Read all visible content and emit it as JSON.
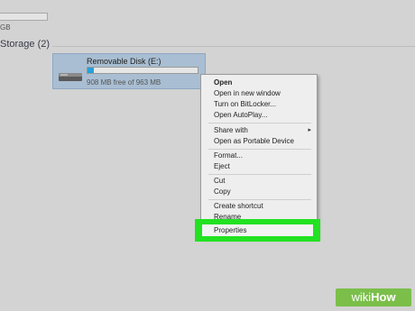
{
  "top": {
    "size_text": "GB"
  },
  "section": {
    "title": "Storage (2)"
  },
  "drive": {
    "name": "Removable Disk (E:)",
    "free_text": "908 MB free of 963 MB",
    "used_fraction": 0.057,
    "bar_color": "#26a0da"
  },
  "context_menu": {
    "items": [
      {
        "label": "Open",
        "bold": true
      },
      {
        "label": "Open in new window"
      },
      {
        "label": "Turn on BitLocker..."
      },
      {
        "label": "Open AutoPlay..."
      },
      {
        "label": "Share with",
        "has_submenu": true
      },
      {
        "label": "Open as Portable Device"
      },
      {
        "label": "Format..."
      },
      {
        "label": "Eject"
      },
      {
        "label": "Cut"
      },
      {
        "label": "Copy"
      },
      {
        "label": "Create shortcut"
      },
      {
        "label": "Rename"
      },
      {
        "label": "Properties"
      }
    ],
    "highlight_color": "#22e222"
  },
  "watermark": {
    "wiki": "wiki",
    "how": "How"
  }
}
